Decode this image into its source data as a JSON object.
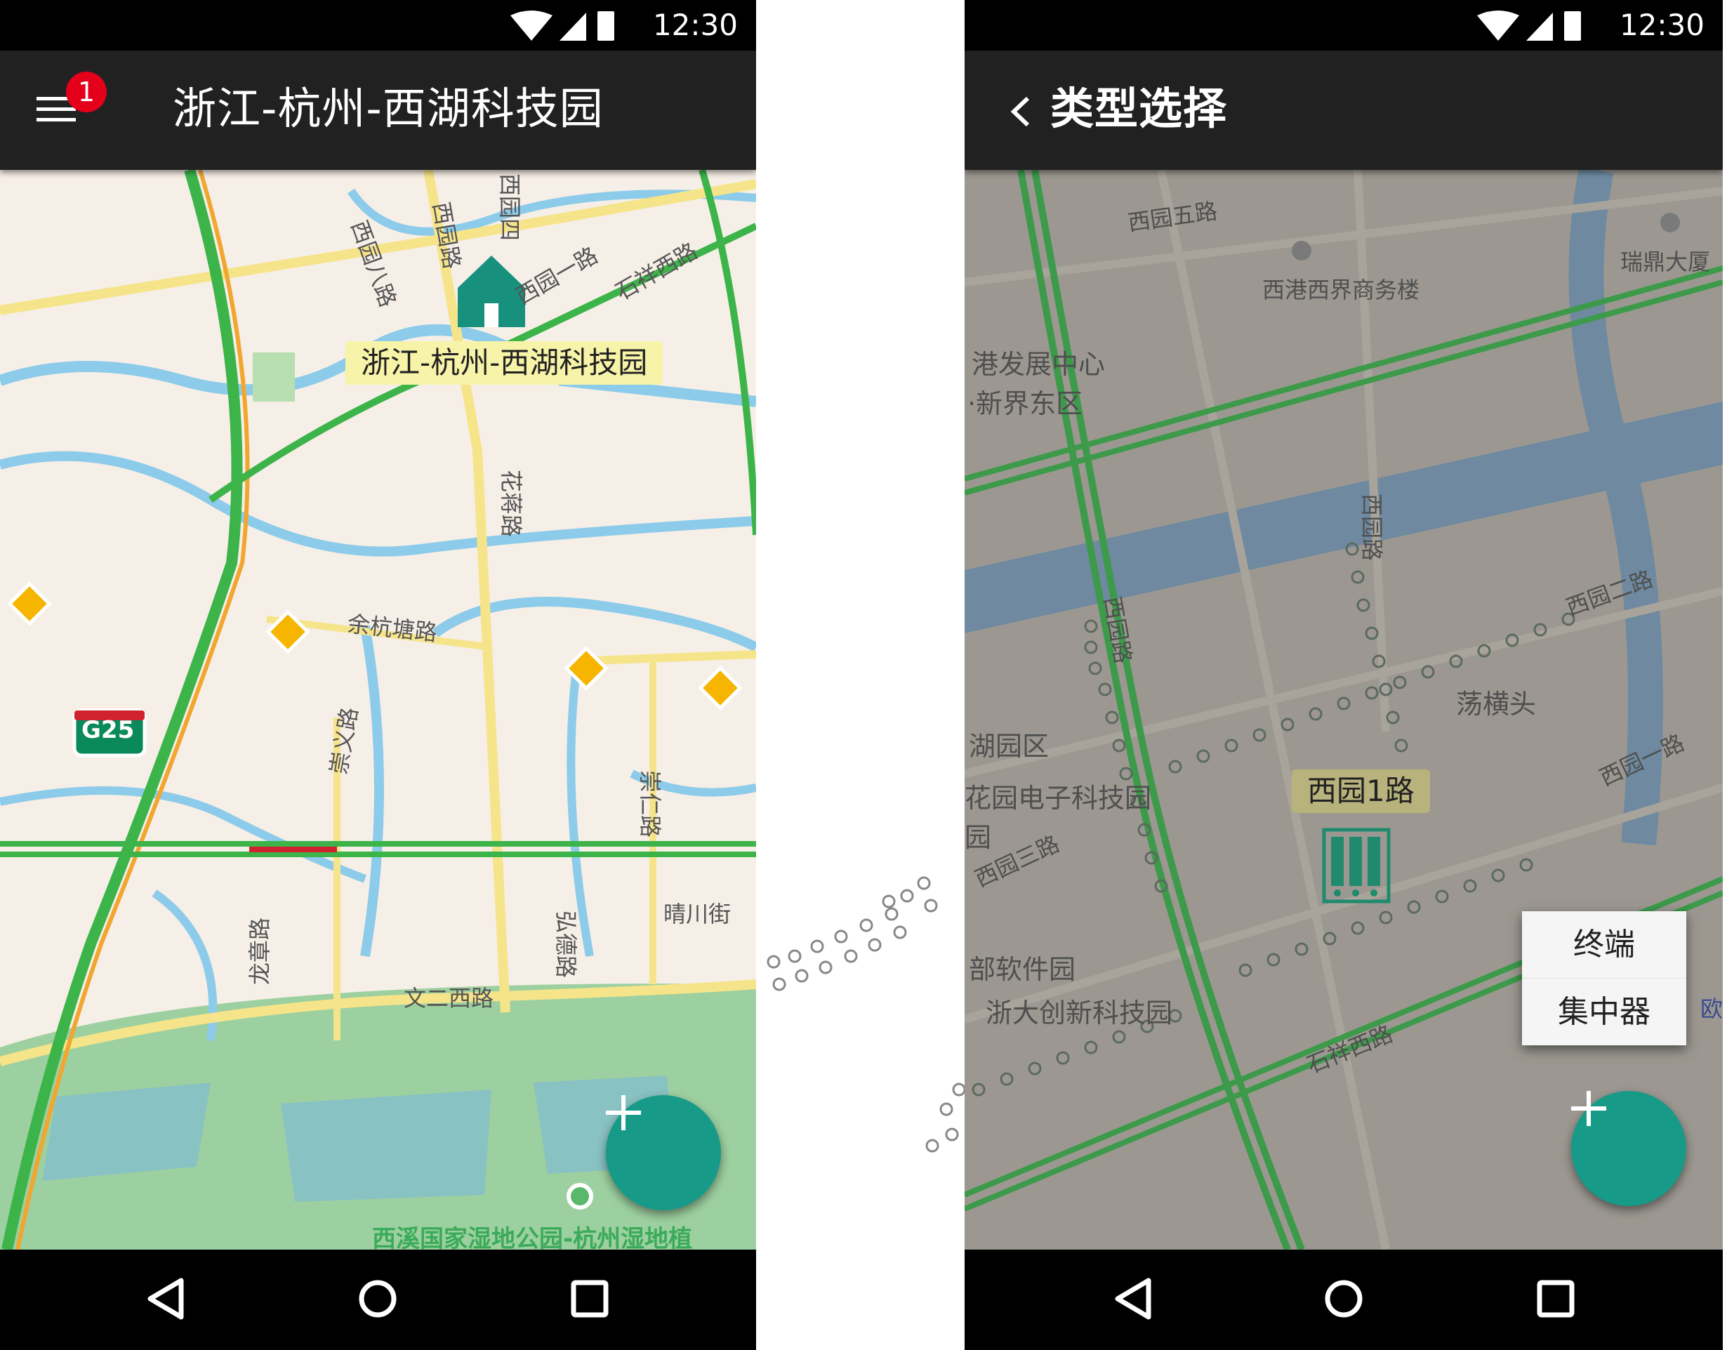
{
  "left_screen": {
    "status_time": "12:30",
    "menu_badge_count": "1",
    "title": "浙江-杭州-西湖科技园",
    "pin_label": "浙江-杭州-西湖科技园",
    "map_labels": {
      "road_1": "余杭塘路",
      "road_2": "花蒋路",
      "road_3": "崇义路",
      "road_4": "崇仁路",
      "road_5": "晴川街",
      "road_6": "文二西路",
      "road_7": "龙章路",
      "road_8": "弘德路",
      "road_9": "西园一路",
      "road_10": "石祥西路",
      "road_11": "西园八路",
      "road_12": "西园路",
      "road_13": "西园四",
      "highway": "G25",
      "park": "西溪国家湿地公园-杭州湿地植"
    },
    "fab_icon": "plus-icon"
  },
  "right_screen": {
    "status_time": "12:30",
    "title": "类型选择",
    "pin_label": "西园1路",
    "map_labels": {
      "l1": "西园五路",
      "l2": "西港西界商务楼",
      "l3": "瑞鼎大厦",
      "l4": "港发展中心",
      "l5": "·新界东区",
      "l6": "西园路",
      "l7": "西园路",
      "l8": "西园二路",
      "l9": "荡横头",
      "l10": "湖园区",
      "l11": "花园电子科技园",
      "l12": "西园一路",
      "l13": "部软件园",
      "l14": "浙大创新科技园",
      "l15": "石祥西路",
      "l16": "欧",
      "l17": "西园三路",
      "l18": "园"
    },
    "menu": {
      "items": [
        "终端",
        "集中器"
      ]
    },
    "fab_icon": "plus-icon"
  },
  "colors": {
    "fab": "#179b88",
    "appbar": "#212121",
    "badge": "#e4001b",
    "pin_label_bg": "#f7f3a8",
    "traffic_green": "#3cb44a",
    "road_yellow": "#f6e48a",
    "water": "#8ccbe9"
  }
}
